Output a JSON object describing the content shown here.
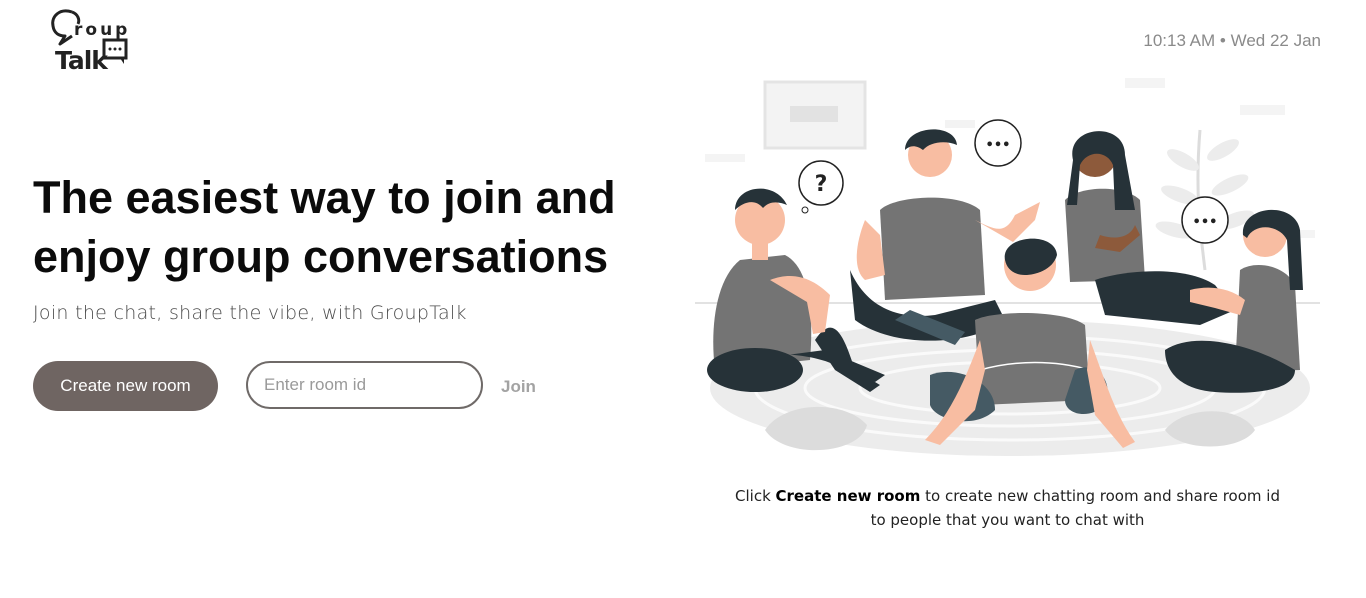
{
  "brand": {
    "line1": "roup",
    "line2": "Talk"
  },
  "clock": {
    "text": "10:13 AM • Wed 22 Jan"
  },
  "hero": {
    "headline_line1": "The easiest way to join and",
    "headline_line2": "enjoy group conversations",
    "tagline": "Join the chat, share the vibe, with GroupTalk"
  },
  "actions": {
    "create_label": "Create new room",
    "room_input_placeholder": "Enter room id",
    "room_input_value": "",
    "join_label": "Join"
  },
  "illustration": {
    "bubble_question": "?",
    "bubble_dots": "•••"
  },
  "caption": {
    "prefix": "Click ",
    "bold": "Create new room",
    "suffix": " to create new chatting room and share room id",
    "line2": "to people that you want to chat with"
  },
  "colors": {
    "button_bg": "#6f6562",
    "input_border": "#6f6a68",
    "join_text": "#a3a3a3",
    "clock_text": "#8a8a8a"
  }
}
